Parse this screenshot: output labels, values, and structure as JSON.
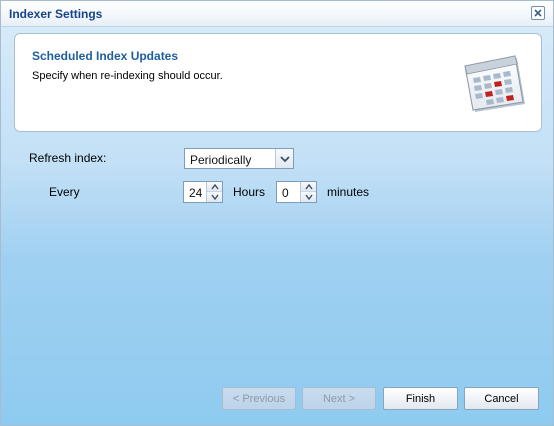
{
  "window": {
    "title": "Indexer Settings"
  },
  "header": {
    "title": "Scheduled Index Updates",
    "description": "Specify when re-indexing should occur.",
    "icon": "calendar-icon"
  },
  "form": {
    "refresh_label": "Refresh index:",
    "refresh_value": "Periodically",
    "every_label": "Every",
    "hours_value": "24",
    "hours_label": "Hours",
    "minutes_value": "0",
    "minutes_label": "minutes"
  },
  "buttons": {
    "previous": "< Previous",
    "next": "Next >",
    "finish": "Finish",
    "cancel": "Cancel"
  }
}
